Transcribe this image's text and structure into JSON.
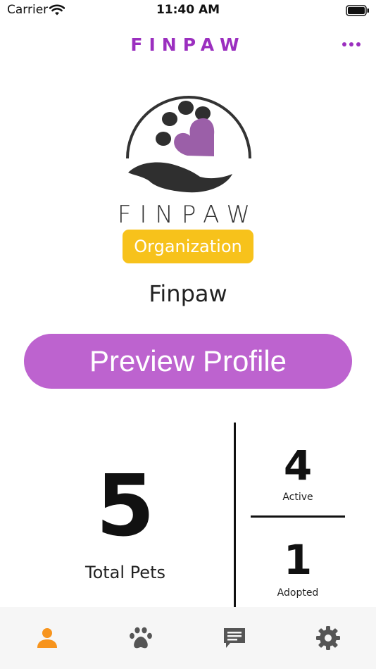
{
  "status_bar": {
    "carrier": "Carrier",
    "time": "11:40 AM"
  },
  "header": {
    "title": "FINPAW"
  },
  "logo": {
    "wordmark": "FINPAW"
  },
  "profile": {
    "type_badge": "Organization",
    "name": "Finpaw",
    "preview_button": "Preview Profile"
  },
  "stats": {
    "total_value": "5",
    "total_label": "Total Pets",
    "active_value": "4",
    "active_label": "Active",
    "adopted_value": "1",
    "adopted_label": "Adopted"
  },
  "tabbar": {
    "tabs": [
      {
        "icon": "person-icon",
        "active": true
      },
      {
        "icon": "paw-icon",
        "active": false
      },
      {
        "icon": "chat-icon",
        "active": false
      },
      {
        "icon": "gear-icon",
        "active": false
      }
    ]
  },
  "colors": {
    "brand_purple": "#9b2fbf",
    "button_purple": "#bd63cf",
    "badge_yellow": "#f7c21b",
    "tab_active": "#f7941d",
    "tab_inactive": "#555555"
  }
}
